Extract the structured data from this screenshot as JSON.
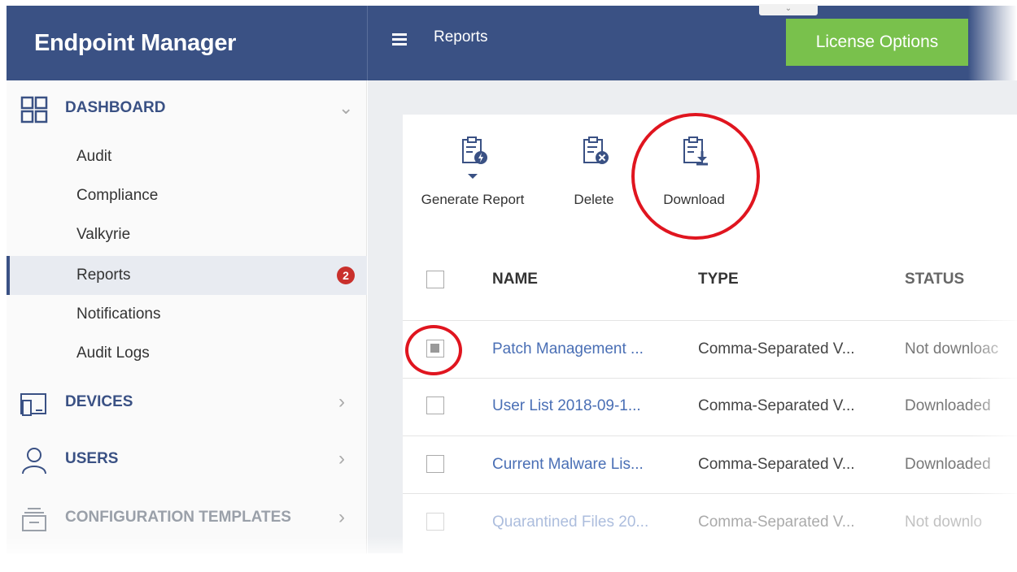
{
  "header": {
    "brand": "Endpoint Manager",
    "page_title": "Reports",
    "collapse_tab": "⌄",
    "license_button": "License Options"
  },
  "sidebar": {
    "sections": [
      {
        "label": "DASHBOARD",
        "icon": "dashboard-grid-icon",
        "expanded": true
      },
      {
        "label": "DEVICES",
        "icon": "devices-icon",
        "expanded": false
      },
      {
        "label": "USERS",
        "icon": "user-icon",
        "expanded": false
      },
      {
        "label": "CONFIGURATION TEMPLATES",
        "icon": "templates-icon",
        "expanded": false
      }
    ],
    "dashboard_items": [
      {
        "label": "Audit"
      },
      {
        "label": "Compliance"
      },
      {
        "label": "Valkyrie"
      },
      {
        "label": "Reports",
        "badge": "2",
        "active": true
      },
      {
        "label": "Notifications"
      },
      {
        "label": "Audit Logs"
      }
    ]
  },
  "toolbar": {
    "generate_report": "Generate Report",
    "delete": "Delete",
    "download": "Download"
  },
  "table": {
    "columns": [
      "NAME",
      "TYPE",
      "STATUS"
    ],
    "rows": [
      {
        "name": "Patch Management ...",
        "type": "Comma-Separated V...",
        "status": "Not downloac",
        "checked": true
      },
      {
        "name": "User List 2018-09-1...",
        "type": "Comma-Separated V...",
        "status": "Downloaded",
        "checked": false
      },
      {
        "name": "Current Malware Lis...",
        "type": "Comma-Separated V...",
        "status": "Downloaded",
        "checked": false
      },
      {
        "name": "Quarantined Files 20...",
        "type": "Comma-Separated V...",
        "status": "Not downlo",
        "checked": false
      }
    ]
  },
  "colors": {
    "header_bg": "#3a5184",
    "license_green": "#79c14c",
    "link_blue": "#4a6fb5",
    "badge_red": "#c9302c",
    "highlight_red": "#e0151f"
  }
}
